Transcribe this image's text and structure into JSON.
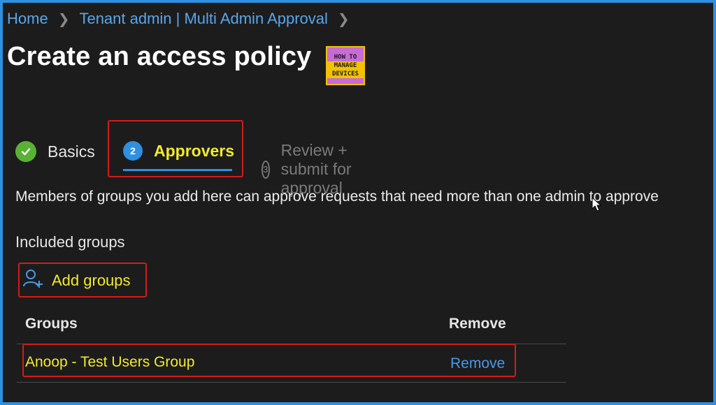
{
  "breadcrumb": {
    "home": "Home",
    "tenant": "Tenant admin | Multi Admin Approval"
  },
  "page": {
    "title": "Create an access policy"
  },
  "logo": {
    "line1": "HOW TO",
    "line2": "MANAGE",
    "line3": "DEVICES"
  },
  "tabs": [
    {
      "label": "Basics",
      "step": "",
      "state": "completed"
    },
    {
      "label": "Approvers",
      "step": "2",
      "state": "active"
    },
    {
      "label": "Review + submit for approval",
      "step": "3",
      "state": "disabled"
    }
  ],
  "description": "Members of groups you add here can approve requests that need more than one admin to approve",
  "included_groups": {
    "label": "Included groups",
    "add_label": "Add groups"
  },
  "table": {
    "headers": {
      "groups": "Groups",
      "remove": "Remove"
    },
    "rows": [
      {
        "group": "Anoop - Test Users Group",
        "action": "Remove"
      }
    ]
  },
  "colors": {
    "accent": "#2f8fe0",
    "highlight_text": "#f3ea2c",
    "annotation_border": "#d41b1b",
    "success": "#5ab135"
  }
}
